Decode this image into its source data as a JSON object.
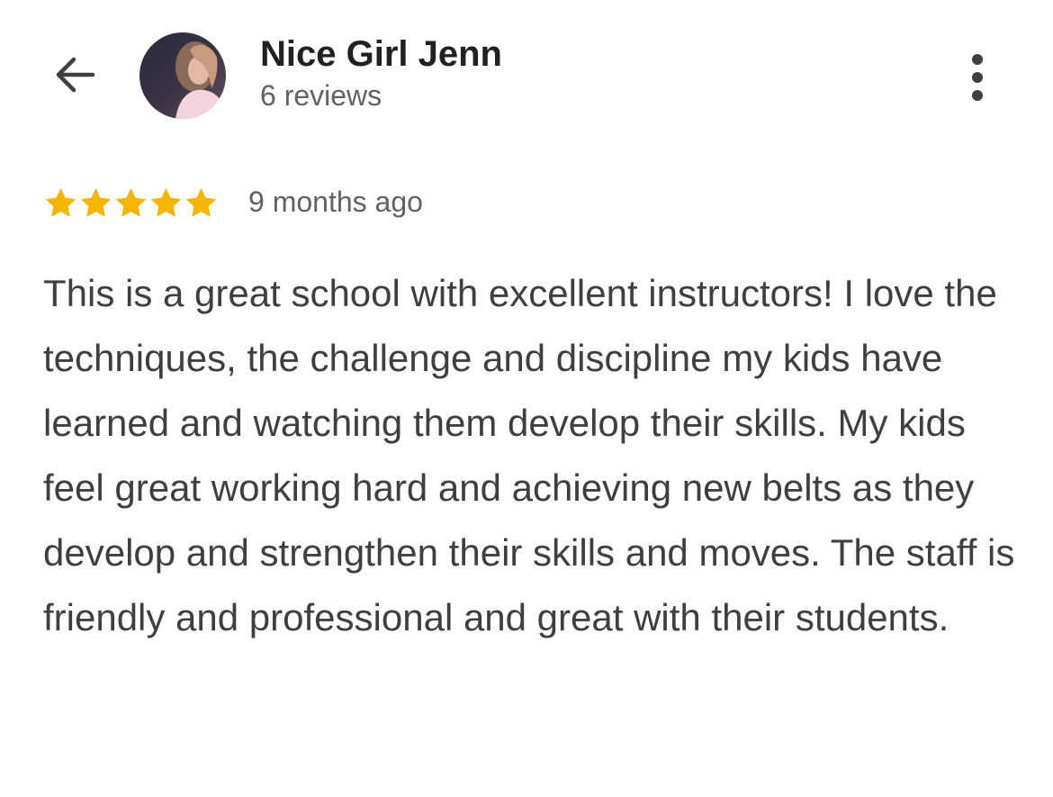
{
  "header": {
    "back_icon": "arrow-left-icon",
    "reviewer_name": "Nice Girl Jenn",
    "review_count": "6 reviews",
    "more_icon": "more-vertical-icon"
  },
  "review": {
    "rating": 5,
    "rating_max": 5,
    "star_color": "#F4B400",
    "date": "9 months ago",
    "text": "This is a great school with excellent instructors! I love the techniques, the challenge and discipline my kids have learned and watching them develop their skills. My kids feel great working hard and achieving new belts as they develop and strengthen their skills and moves. The staff is friendly and professional and great with their students."
  }
}
